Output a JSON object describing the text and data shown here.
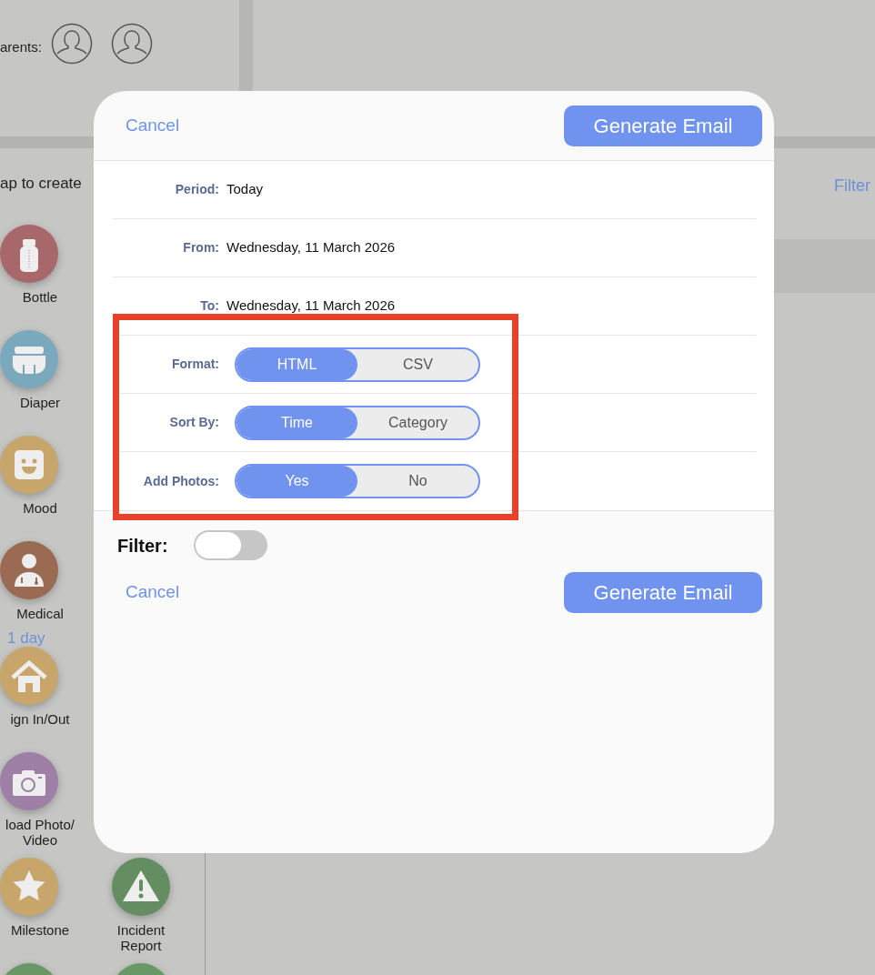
{
  "background": {
    "parents_label": "arents:",
    "hint": "ap to create",
    "filter_link": "Filter",
    "day_label": "1 day",
    "tiles_column_1": [
      {
        "kind": "bottle",
        "label": "Bottle",
        "color": "#a8676a"
      },
      {
        "kind": "diaper",
        "label": "Diaper",
        "color": "#7aa9be"
      },
      {
        "kind": "mood",
        "label": "Mood",
        "color": "#c8a66b"
      },
      {
        "kind": "medical",
        "label": "Medical",
        "color": "#9a6a52"
      },
      {
        "kind": "house",
        "label": "ign In/Out",
        "color": "#c8a66b"
      },
      {
        "kind": "camera",
        "label": "load Photo/ Video",
        "color": "#9e80a6"
      },
      {
        "kind": "star",
        "label": "Milestone",
        "color": "#c8a66b"
      },
      {
        "kind": "partial",
        "color": "#6a9766"
      }
    ],
    "tiles_column_2": [
      {
        "kind": "warning",
        "label": "Incident Report",
        "color": "#648e61"
      },
      {
        "kind": "partial",
        "color": "#6a9766"
      }
    ]
  },
  "dialog": {
    "cancel": "Cancel",
    "generate": "Generate Email",
    "fields": [
      {
        "kind": "text",
        "label": "Period:",
        "value": "Today"
      },
      {
        "kind": "text",
        "label": "From:",
        "value": "Wednesday, 11 March 2026"
      },
      {
        "kind": "text",
        "label": "To:",
        "value": "Wednesday, 11 March 2026"
      },
      {
        "kind": "segmented",
        "label": "Format:",
        "options": [
          {
            "label": "HTML",
            "selected": true
          },
          {
            "label": "CSV",
            "selected": false
          }
        ]
      },
      {
        "kind": "segmented",
        "label": "Sort By:",
        "options": [
          {
            "label": "Time",
            "selected": true
          },
          {
            "label": "Category",
            "selected": false
          }
        ]
      },
      {
        "kind": "segmented",
        "label": "Add Photos:",
        "options": [
          {
            "label": "Yes",
            "selected": true
          },
          {
            "label": "No",
            "selected": false
          }
        ]
      }
    ],
    "filter": {
      "label": "Filter:",
      "on": false
    },
    "footer_cancel": "Cancel",
    "footer_generate": "Generate Email"
  }
}
